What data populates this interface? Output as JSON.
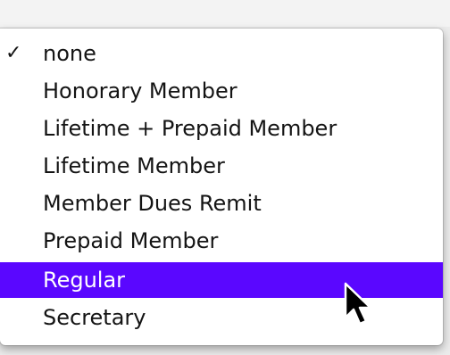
{
  "menu": {
    "items": [
      {
        "label": "none",
        "checked": true
      },
      {
        "label": "Honorary Member",
        "checked": false
      },
      {
        "label": "Lifetime + Prepaid Member",
        "checked": false
      },
      {
        "label": "Lifetime Member",
        "checked": false
      },
      {
        "label": "Member Dues Remit",
        "checked": false
      },
      {
        "label": "Prepaid Member",
        "checked": false
      },
      {
        "label": "Regular",
        "checked": false,
        "highlighted": true
      },
      {
        "label": "Secretary",
        "checked": false
      }
    ],
    "check_glyph": "✓",
    "highlight_color": "#5a07ff"
  },
  "cursor": {
    "icon": "arrow-pointer-icon"
  }
}
